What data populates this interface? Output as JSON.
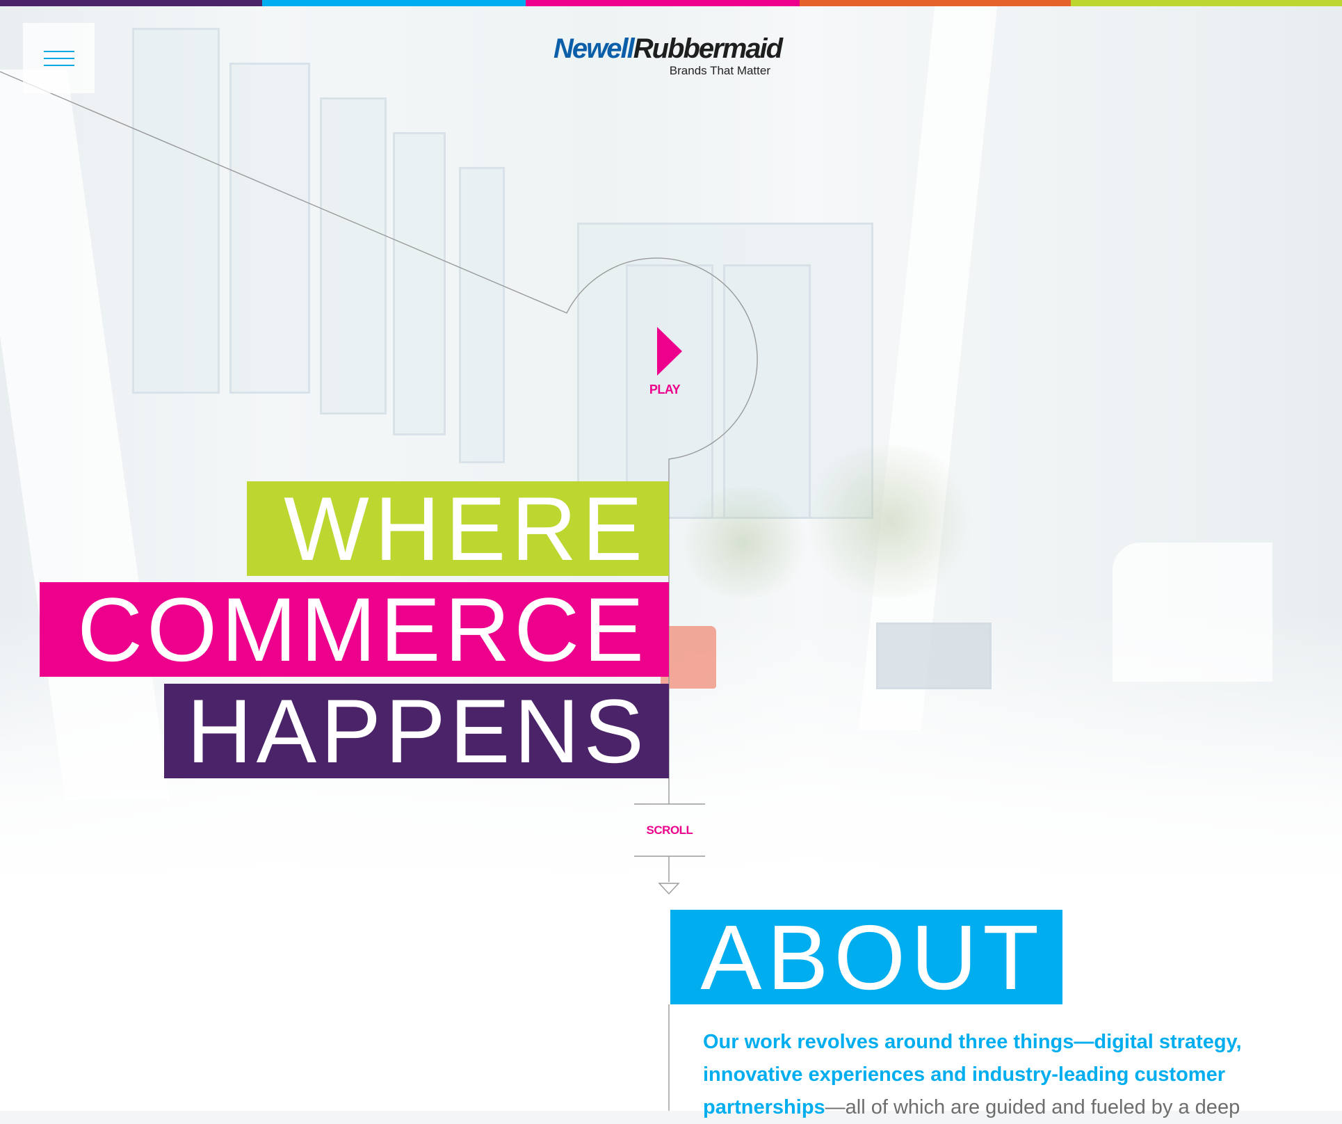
{
  "colors": {
    "stripe_purple": "#4b2368",
    "stripe_blue": "#00aeef",
    "stripe_magenta": "#ec008c",
    "stripe_orange": "#e5622a",
    "stripe_lime": "#bed630",
    "accent_magenta": "#ec008c",
    "accent_blue": "#00aeef"
  },
  "header": {
    "menu_icon": "hamburger-menu-icon",
    "logo_part1": "Newell",
    "logo_part2": "Rubbermaid",
    "logo_tagline": "Brands That Matter"
  },
  "hero": {
    "play_icon": "play-triangle-icon",
    "play_label": "PLAY",
    "headline": [
      "WHERE",
      "COMMERCE",
      "HAPPENS"
    ],
    "scroll_label": "SCROLL",
    "scroll_icon": "down-arrow-icon"
  },
  "about": {
    "heading": "ABOUT",
    "intro_highlight": "Our work revolves around three things—digital strategy, innovative experiences and industry-leading customer partnerships",
    "intro_rest": "—all of which are guided and fueled by a deep"
  }
}
